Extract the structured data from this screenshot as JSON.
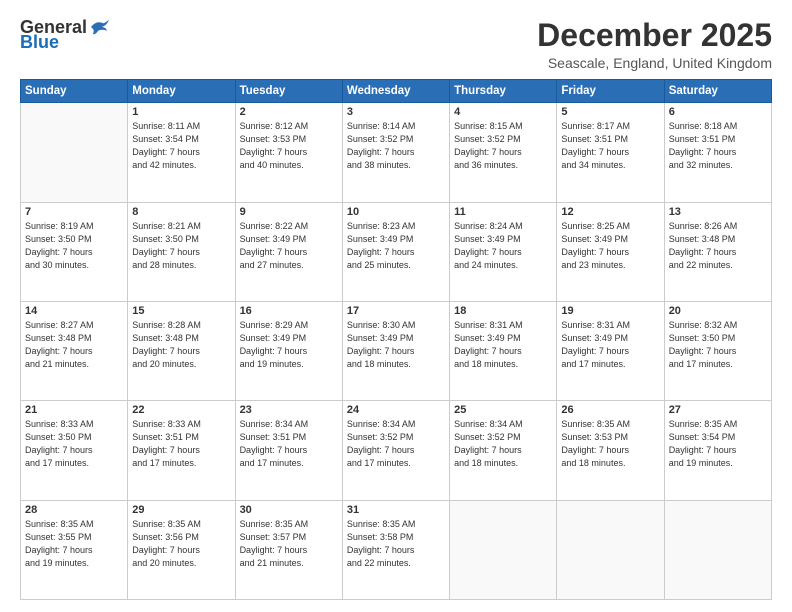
{
  "logo": {
    "general": "General",
    "blue": "Blue"
  },
  "title": "December 2025",
  "subtitle": "Seascale, England, United Kingdom",
  "days": [
    "Sunday",
    "Monday",
    "Tuesday",
    "Wednesday",
    "Thursday",
    "Friday",
    "Saturday"
  ],
  "weeks": [
    [
      {
        "day": "",
        "info": ""
      },
      {
        "day": "1",
        "info": "Sunrise: 8:11 AM\nSunset: 3:54 PM\nDaylight: 7 hours\nand 42 minutes."
      },
      {
        "day": "2",
        "info": "Sunrise: 8:12 AM\nSunset: 3:53 PM\nDaylight: 7 hours\nand 40 minutes."
      },
      {
        "day": "3",
        "info": "Sunrise: 8:14 AM\nSunset: 3:52 PM\nDaylight: 7 hours\nand 38 minutes."
      },
      {
        "day": "4",
        "info": "Sunrise: 8:15 AM\nSunset: 3:52 PM\nDaylight: 7 hours\nand 36 minutes."
      },
      {
        "day": "5",
        "info": "Sunrise: 8:17 AM\nSunset: 3:51 PM\nDaylight: 7 hours\nand 34 minutes."
      },
      {
        "day": "6",
        "info": "Sunrise: 8:18 AM\nSunset: 3:51 PM\nDaylight: 7 hours\nand 32 minutes."
      }
    ],
    [
      {
        "day": "7",
        "info": "Sunrise: 8:19 AM\nSunset: 3:50 PM\nDaylight: 7 hours\nand 30 minutes."
      },
      {
        "day": "8",
        "info": "Sunrise: 8:21 AM\nSunset: 3:50 PM\nDaylight: 7 hours\nand 28 minutes."
      },
      {
        "day": "9",
        "info": "Sunrise: 8:22 AM\nSunset: 3:49 PM\nDaylight: 7 hours\nand 27 minutes."
      },
      {
        "day": "10",
        "info": "Sunrise: 8:23 AM\nSunset: 3:49 PM\nDaylight: 7 hours\nand 25 minutes."
      },
      {
        "day": "11",
        "info": "Sunrise: 8:24 AM\nSunset: 3:49 PM\nDaylight: 7 hours\nand 24 minutes."
      },
      {
        "day": "12",
        "info": "Sunrise: 8:25 AM\nSunset: 3:49 PM\nDaylight: 7 hours\nand 23 minutes."
      },
      {
        "day": "13",
        "info": "Sunrise: 8:26 AM\nSunset: 3:48 PM\nDaylight: 7 hours\nand 22 minutes."
      }
    ],
    [
      {
        "day": "14",
        "info": "Sunrise: 8:27 AM\nSunset: 3:48 PM\nDaylight: 7 hours\nand 21 minutes."
      },
      {
        "day": "15",
        "info": "Sunrise: 8:28 AM\nSunset: 3:48 PM\nDaylight: 7 hours\nand 20 minutes."
      },
      {
        "day": "16",
        "info": "Sunrise: 8:29 AM\nSunset: 3:49 PM\nDaylight: 7 hours\nand 19 minutes."
      },
      {
        "day": "17",
        "info": "Sunrise: 8:30 AM\nSunset: 3:49 PM\nDaylight: 7 hours\nand 18 minutes."
      },
      {
        "day": "18",
        "info": "Sunrise: 8:31 AM\nSunset: 3:49 PM\nDaylight: 7 hours\nand 18 minutes."
      },
      {
        "day": "19",
        "info": "Sunrise: 8:31 AM\nSunset: 3:49 PM\nDaylight: 7 hours\nand 17 minutes."
      },
      {
        "day": "20",
        "info": "Sunrise: 8:32 AM\nSunset: 3:50 PM\nDaylight: 7 hours\nand 17 minutes."
      }
    ],
    [
      {
        "day": "21",
        "info": "Sunrise: 8:33 AM\nSunset: 3:50 PM\nDaylight: 7 hours\nand 17 minutes."
      },
      {
        "day": "22",
        "info": "Sunrise: 8:33 AM\nSunset: 3:51 PM\nDaylight: 7 hours\nand 17 minutes."
      },
      {
        "day": "23",
        "info": "Sunrise: 8:34 AM\nSunset: 3:51 PM\nDaylight: 7 hours\nand 17 minutes."
      },
      {
        "day": "24",
        "info": "Sunrise: 8:34 AM\nSunset: 3:52 PM\nDaylight: 7 hours\nand 17 minutes."
      },
      {
        "day": "25",
        "info": "Sunrise: 8:34 AM\nSunset: 3:52 PM\nDaylight: 7 hours\nand 18 minutes."
      },
      {
        "day": "26",
        "info": "Sunrise: 8:35 AM\nSunset: 3:53 PM\nDaylight: 7 hours\nand 18 minutes."
      },
      {
        "day": "27",
        "info": "Sunrise: 8:35 AM\nSunset: 3:54 PM\nDaylight: 7 hours\nand 19 minutes."
      }
    ],
    [
      {
        "day": "28",
        "info": "Sunrise: 8:35 AM\nSunset: 3:55 PM\nDaylight: 7 hours\nand 19 minutes."
      },
      {
        "day": "29",
        "info": "Sunrise: 8:35 AM\nSunset: 3:56 PM\nDaylight: 7 hours\nand 20 minutes."
      },
      {
        "day": "30",
        "info": "Sunrise: 8:35 AM\nSunset: 3:57 PM\nDaylight: 7 hours\nand 21 minutes."
      },
      {
        "day": "31",
        "info": "Sunrise: 8:35 AM\nSunset: 3:58 PM\nDaylight: 7 hours\nand 22 minutes."
      },
      {
        "day": "",
        "info": ""
      },
      {
        "day": "",
        "info": ""
      },
      {
        "day": "",
        "info": ""
      }
    ]
  ]
}
